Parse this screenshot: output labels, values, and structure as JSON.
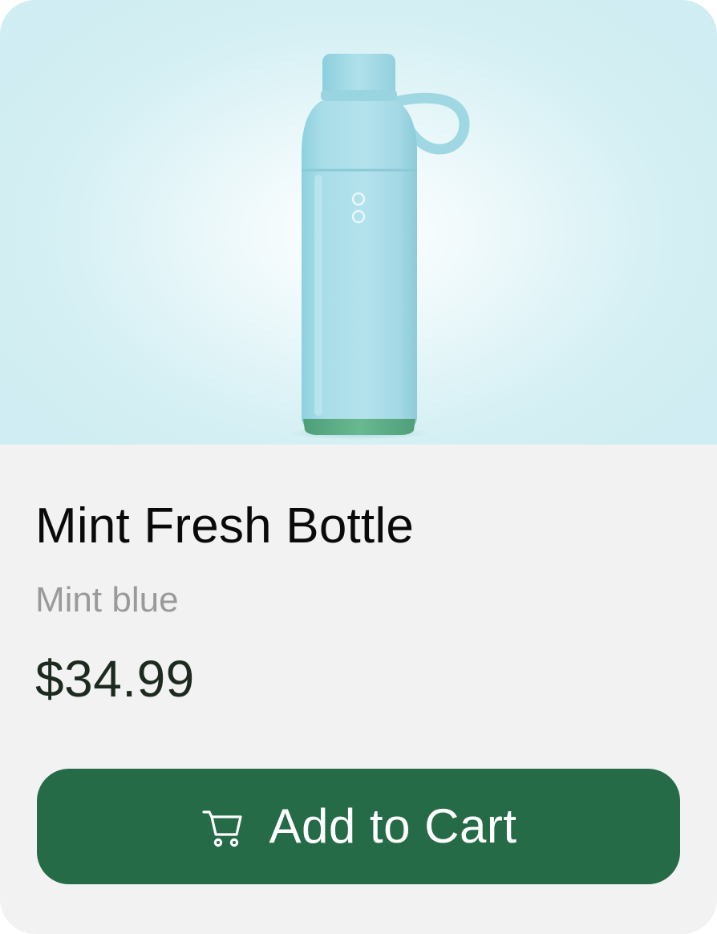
{
  "product": {
    "name": "Mint Fresh Bottle",
    "variant": "Mint blue",
    "price": "$34.99",
    "image_subject": "water-bottle",
    "colors": {
      "bottle": "#b2e0ea",
      "bottle_base": "#5faf8a",
      "image_background": "#cfedf2"
    }
  },
  "actions": {
    "add_to_cart_label": "Add to Cart",
    "add_to_cart_icon": "shopping-cart-icon",
    "button_color": "#256b47"
  },
  "card": {
    "background": "#f2f2f2"
  }
}
